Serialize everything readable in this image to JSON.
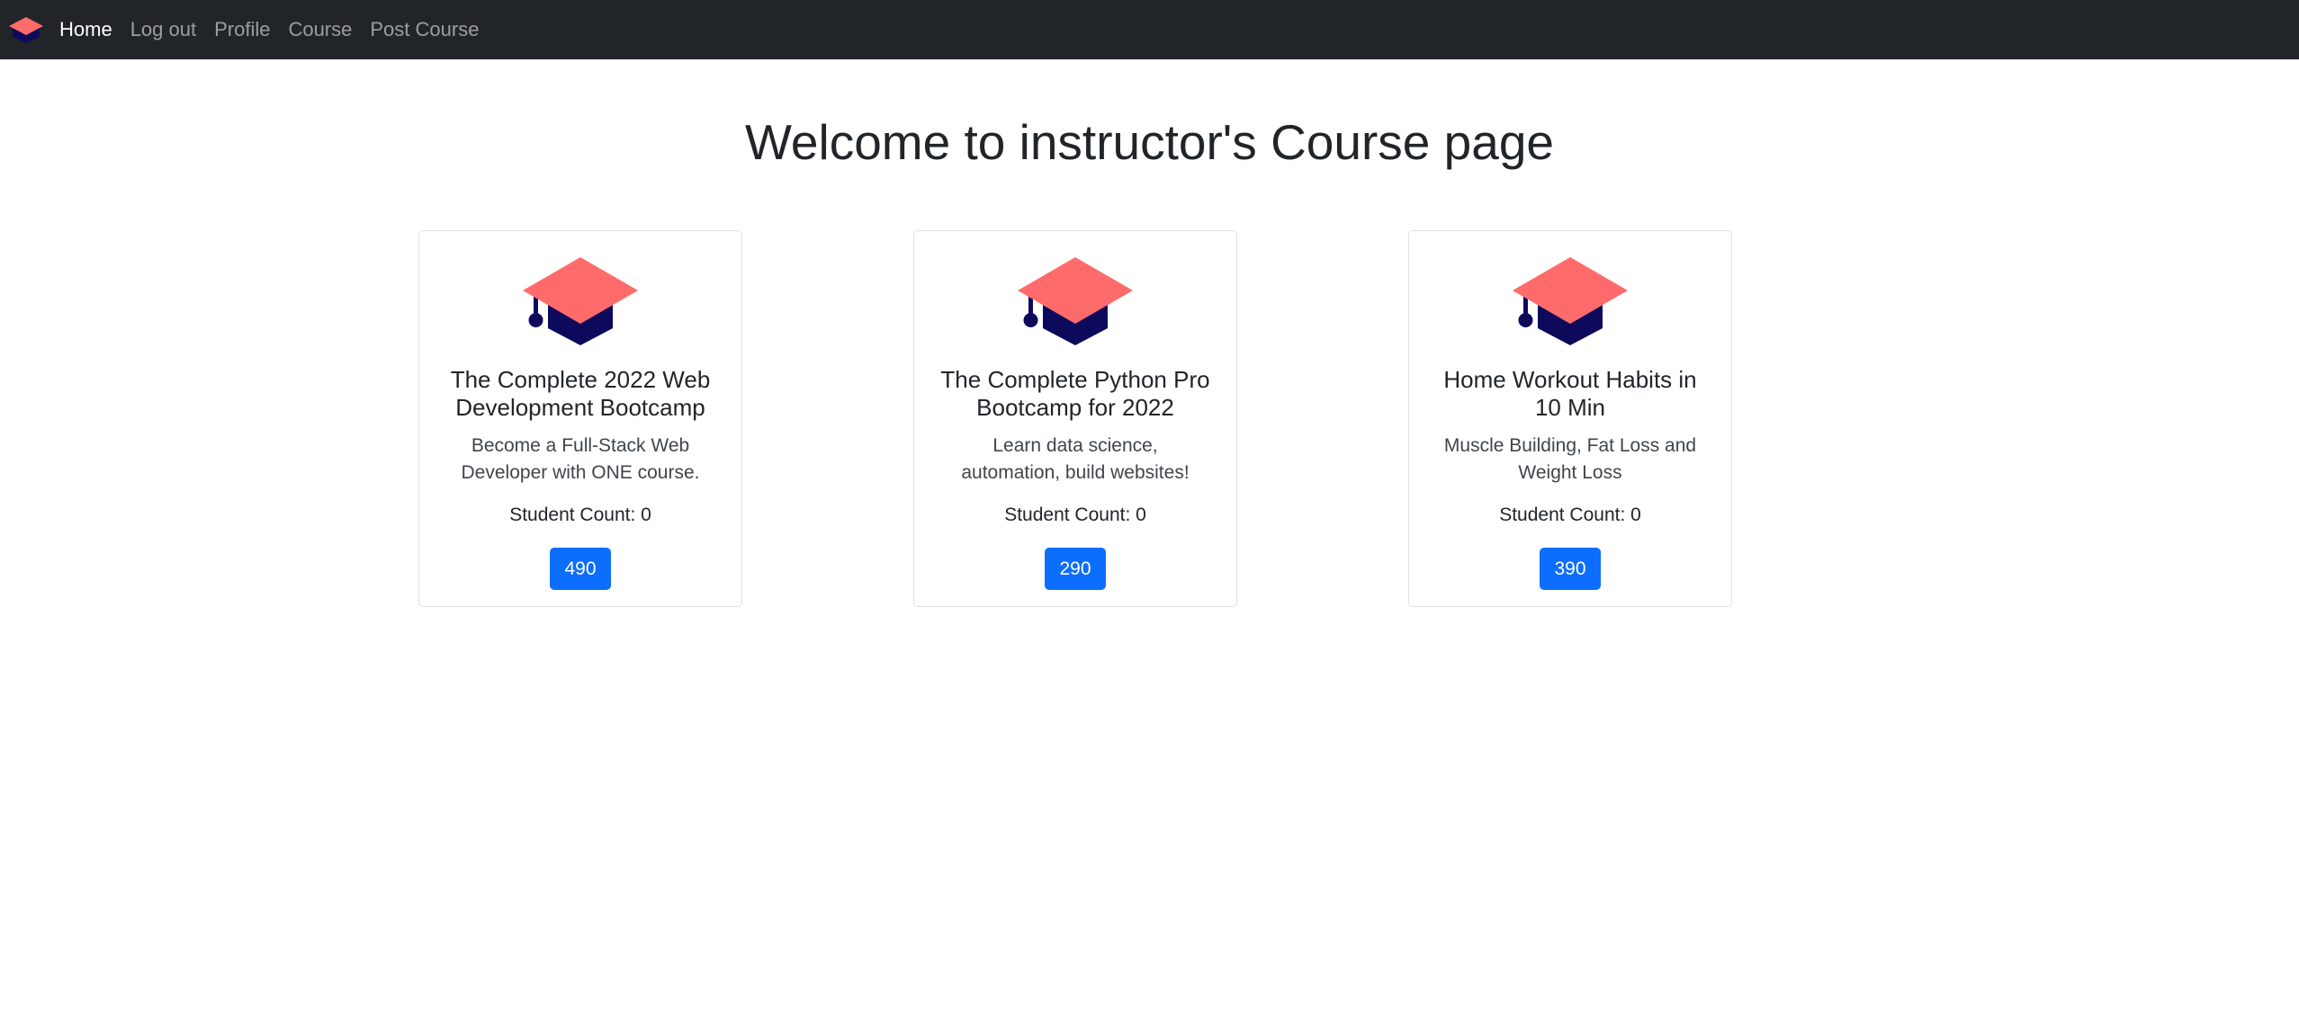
{
  "nav": {
    "items": [
      {
        "label": "Home",
        "active": true
      },
      {
        "label": "Log out",
        "active": false
      },
      {
        "label": "Profile",
        "active": false
      },
      {
        "label": "Course",
        "active": false
      },
      {
        "label": "Post Course",
        "active": false
      }
    ]
  },
  "page": {
    "title": "Welcome to instructor's Course page"
  },
  "colors": {
    "navbar_bg": "#212529",
    "cap_top": "#ff6b6b",
    "cap_base": "#0d0a5c",
    "button_bg": "#0d6efd"
  },
  "icons": {
    "brand": "graduation-cap-icon",
    "course": "graduation-cap-icon"
  },
  "courses": [
    {
      "title": "The Complete 2022 Web Development Bootcamp",
      "description": "Become a Full-Stack Web Developer with ONE course.",
      "student_count": "Student Count: 0",
      "price": "490"
    },
    {
      "title": "The Complete Python Pro Bootcamp for 2022",
      "description": "Learn data science, automation, build websites!",
      "student_count": "Student Count: 0",
      "price": "290"
    },
    {
      "title": "Home Workout Habits in 10 Min",
      "description": "Muscle Building, Fat Loss and Weight Loss",
      "student_count": "Student Count: 0",
      "price": "390"
    }
  ]
}
